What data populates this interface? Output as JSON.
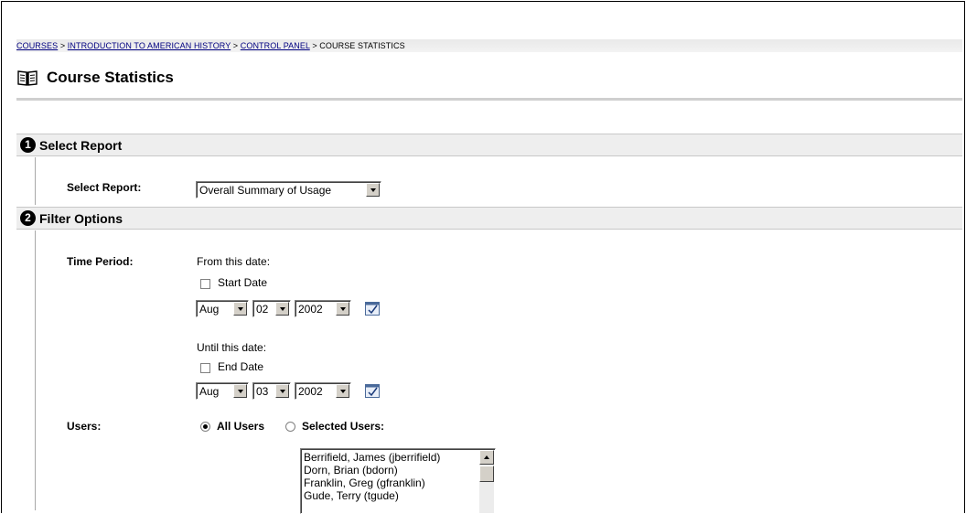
{
  "breadcrumb": {
    "courses": "COURSES",
    "sep1": " > ",
    "course": "INTRODUCTION TO AMERICAN HISTORY",
    "sep2": " > ",
    "control_panel": "CONTROL PANEL",
    "sep3": " > ",
    "current": "COURSE STATISTICS"
  },
  "page": {
    "title": "Course Statistics",
    "icon": "book-icon"
  },
  "step1": {
    "number": "1",
    "title": "Select Report",
    "label": "Select Report:",
    "select_value": "Overall Summary of Usage"
  },
  "step2": {
    "number": "2",
    "title": "Filter Options",
    "time_period_label": "Time Period:",
    "from_text": "From this date:",
    "start_checkbox_label": "Start Date",
    "start_month": "Aug",
    "start_day": "02",
    "start_year": "2002",
    "until_text": "Until this date:",
    "end_checkbox_label": "End Date",
    "end_month": "Aug",
    "end_day": "03",
    "end_year": "2002",
    "users_label": "Users:",
    "all_users_label": "All Users",
    "selected_users_label": "Selected Users:",
    "users_list": [
      "Berrifield, James (jberrifield)",
      "Dorn, Brian (bdorn)",
      "Franklin, Greg (gfranklin)",
      "Gude, Terry (tgude)"
    ]
  },
  "colors": {
    "link": "#000080",
    "header_bg": "#eeeeee",
    "control_face": "#d4d0c8"
  }
}
